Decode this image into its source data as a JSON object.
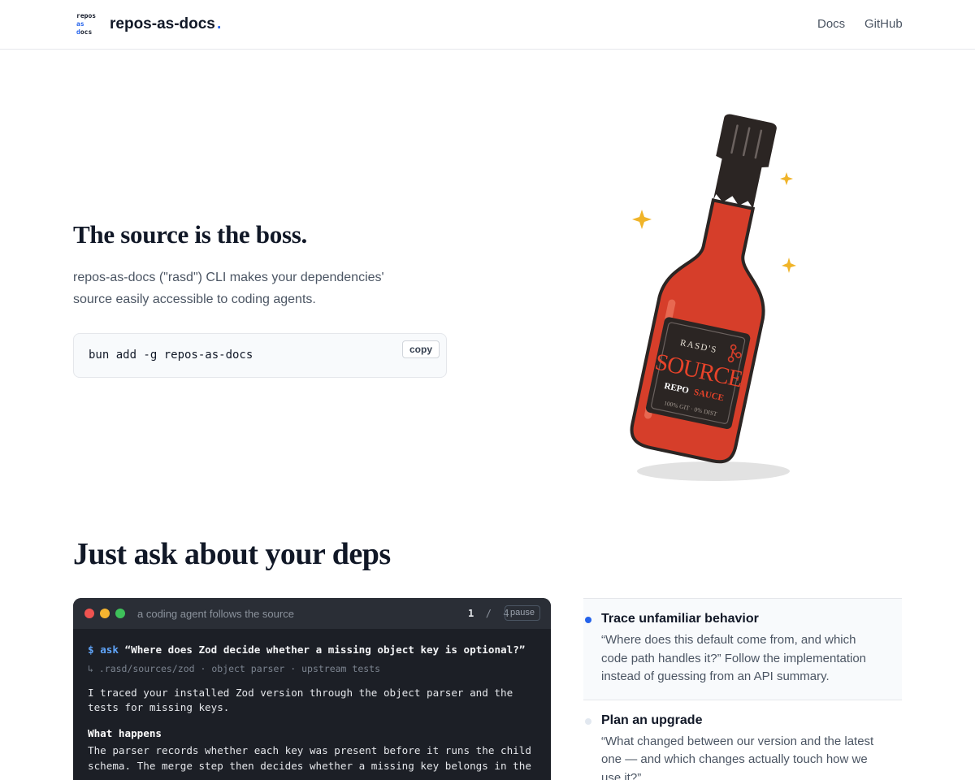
{
  "header": {
    "logo_lines": [
      "repos",
      "as",
      "docs"
    ],
    "brand": "repos-as-docs",
    "brand_dot": ".",
    "nav": [
      {
        "label": "Docs"
      },
      {
        "label": "GitHub"
      }
    ]
  },
  "hero": {
    "title": "The source is the boss.",
    "subtitle": "repos-as-docs (\"rasd\") CLI makes your dependencies' source easily accessible to coding agents.",
    "install_command": "bun add -g repos-as-docs",
    "copy_label": "copy"
  },
  "illustration": {
    "label_top": "RASD'S",
    "label_main": "SOURCE",
    "label_repo": "REPO",
    "label_sauce": "SAUCE",
    "label_bottom": "100% GIT · 0% DIST",
    "colors": {
      "bottle": "#d63e2a",
      "cap": "#2b2523",
      "sparkle": "#f0b429"
    }
  },
  "section": {
    "title": "Just ask about your deps"
  },
  "terminal": {
    "caption": "a coding agent follows the source",
    "step_current": "1",
    "step_sep": "/",
    "step_total": "4",
    "pause_label": "pause",
    "prompt": "$",
    "command": "ask",
    "question": "“Where does Zod decide whether a missing object key is optional?”",
    "path_line": "↳ .rasd/sources/zod · object parser · upstream tests",
    "response": "I traced your installed Zod version through the object parser and the tests for missing keys.",
    "heading": "What happens",
    "detail": "The parser records whether each key was present before it runs the child schema. The merge step then decides whether a missing key belongs in the"
  },
  "use_cases": [
    {
      "title": "Trace unfamiliar behavior",
      "description": "“Where does this default come from, and which code path handles it?” Follow the implementation instead of guessing from an API summary.",
      "active": true
    },
    {
      "title": "Plan an upgrade",
      "description": "“What changed between our version and the latest one — and which changes actually touch how we use it?”",
      "active": false
    }
  ]
}
